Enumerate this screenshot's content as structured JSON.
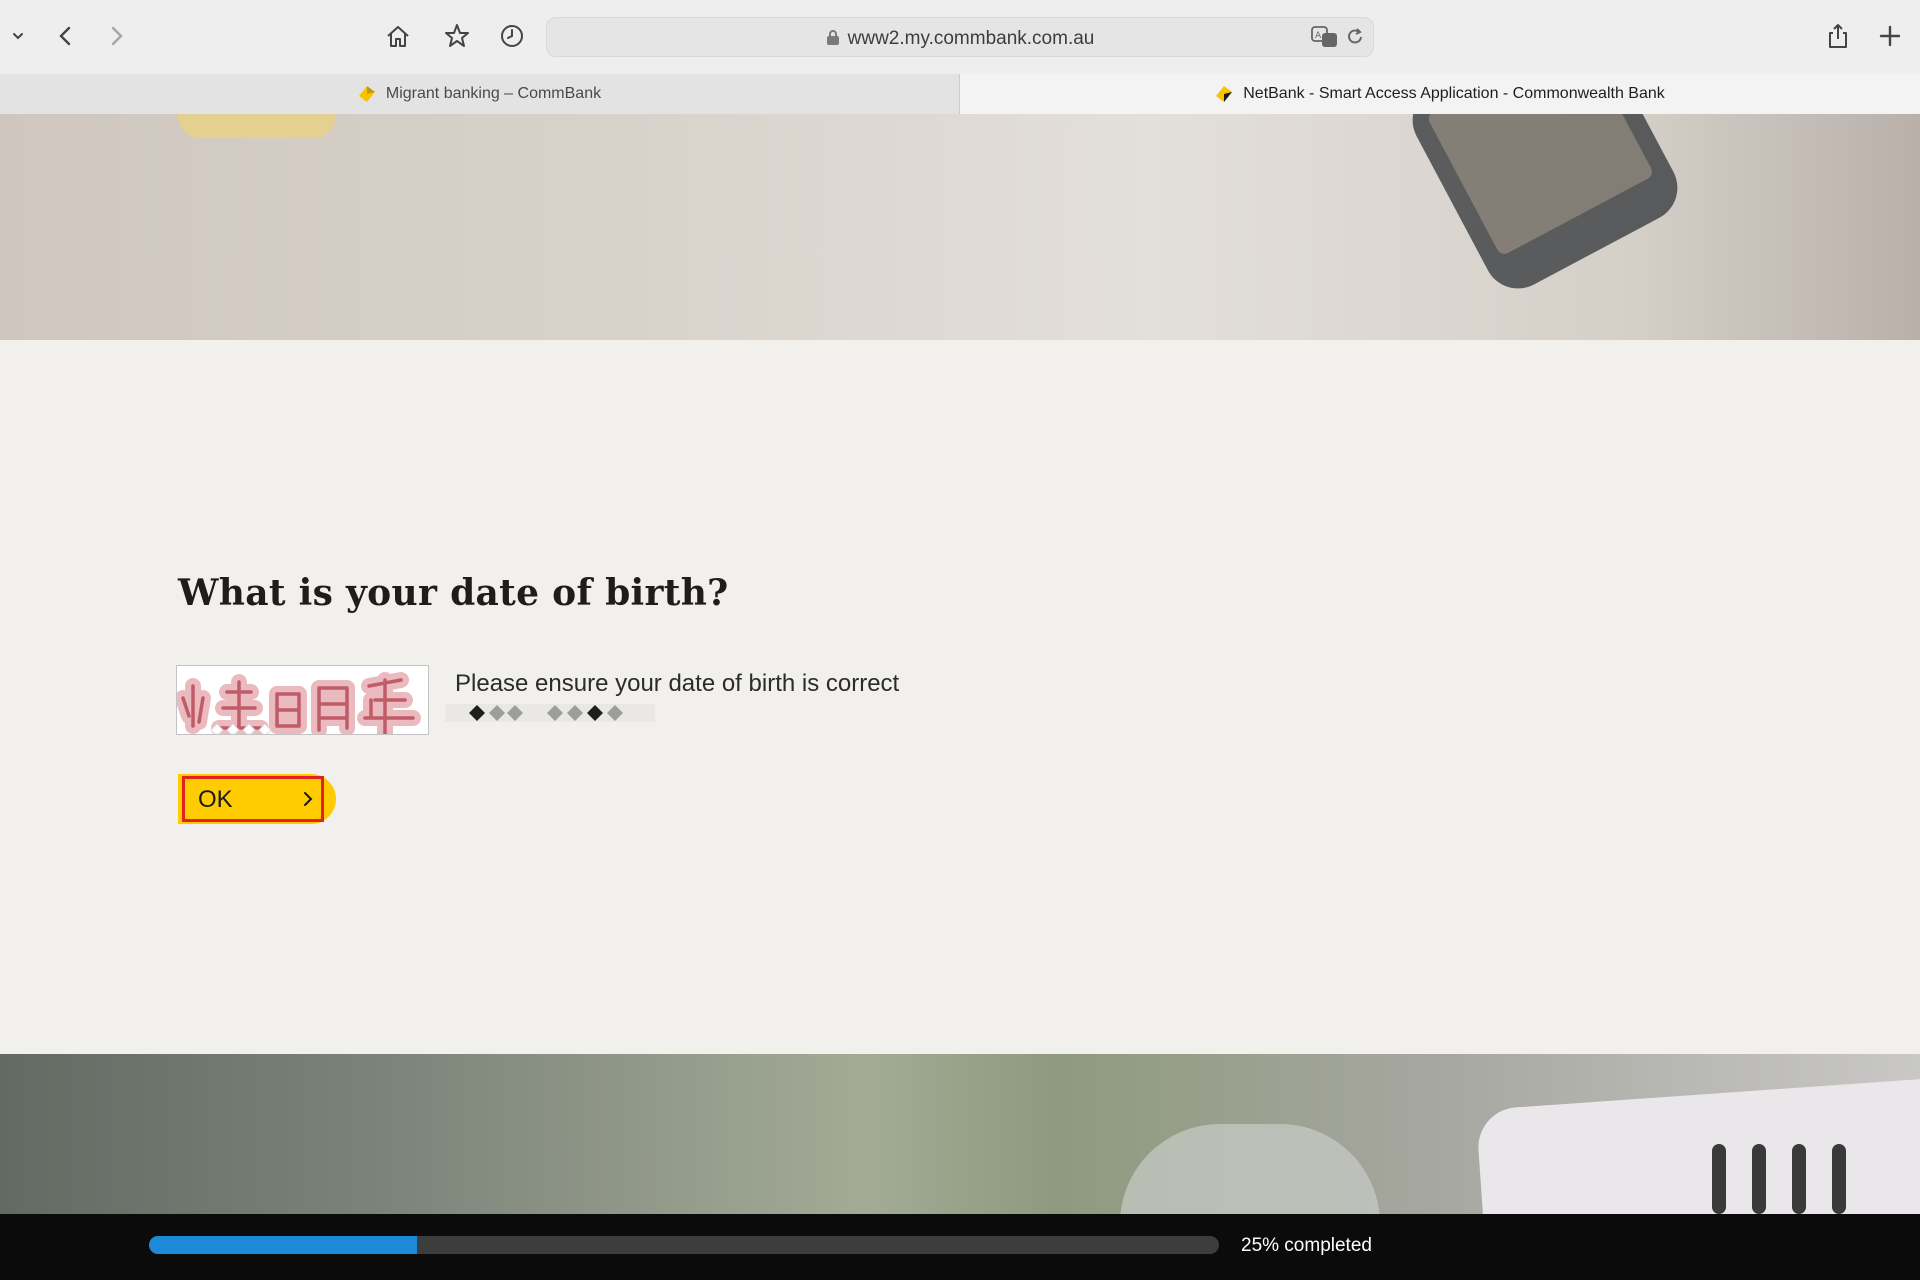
{
  "browser": {
    "url": "www2.my.commbank.com.au",
    "tabs": [
      {
        "title": "Migrant banking – CommBank",
        "active": false
      },
      {
        "title": "NetBank - Smart Access Application - Commonwealth Bank",
        "active": true
      }
    ],
    "icons": [
      "chevron-down-icon",
      "back-icon",
      "forward-icon",
      "home-icon",
      "star-icon",
      "history-icon",
      "lock-icon",
      "translate-icon",
      "reload-icon",
      "share-icon",
      "new-tab-icon"
    ]
  },
  "form": {
    "question": "What is your date of birth?",
    "hint": "Please ensure your date of birth is correct",
    "dob_handwriting": "出生日月年",
    "ok_label": "OK"
  },
  "progress": {
    "fraction": 0.25,
    "label": "25% completed"
  },
  "colors": {
    "brand_yellow": "#ffcc00",
    "highlight_red": "#e6201f",
    "progress_blue": "#1c8ad8",
    "page_bg": "#f1f0ec"
  }
}
